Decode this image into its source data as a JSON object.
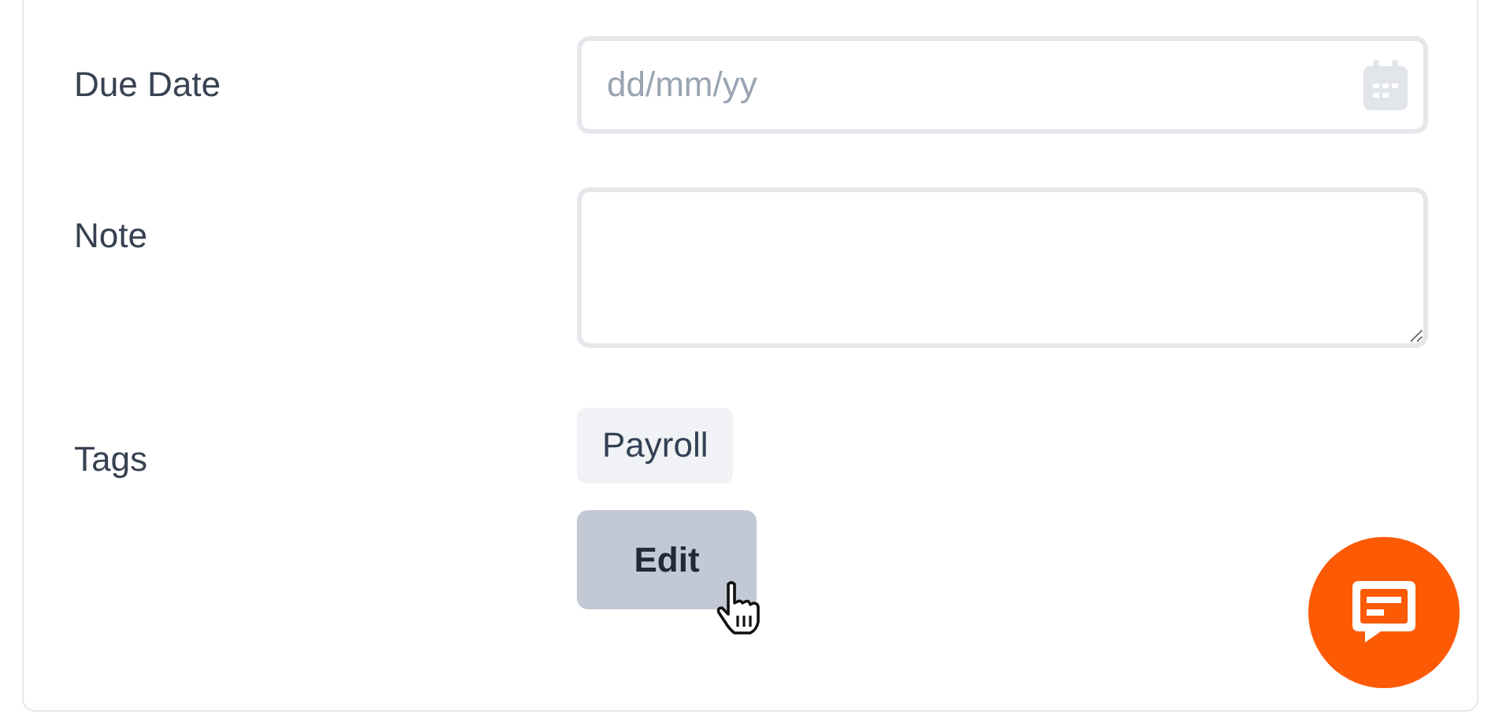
{
  "form": {
    "fields": [
      {
        "kind": "date",
        "label": "Due Date",
        "placeholder": "dd/mm/yy"
      },
      {
        "kind": "textarea",
        "label": "Note"
      },
      {
        "kind": "tags",
        "label": "Tags",
        "tags": [
          "Payroll"
        ],
        "button": "Edit"
      }
    ]
  }
}
